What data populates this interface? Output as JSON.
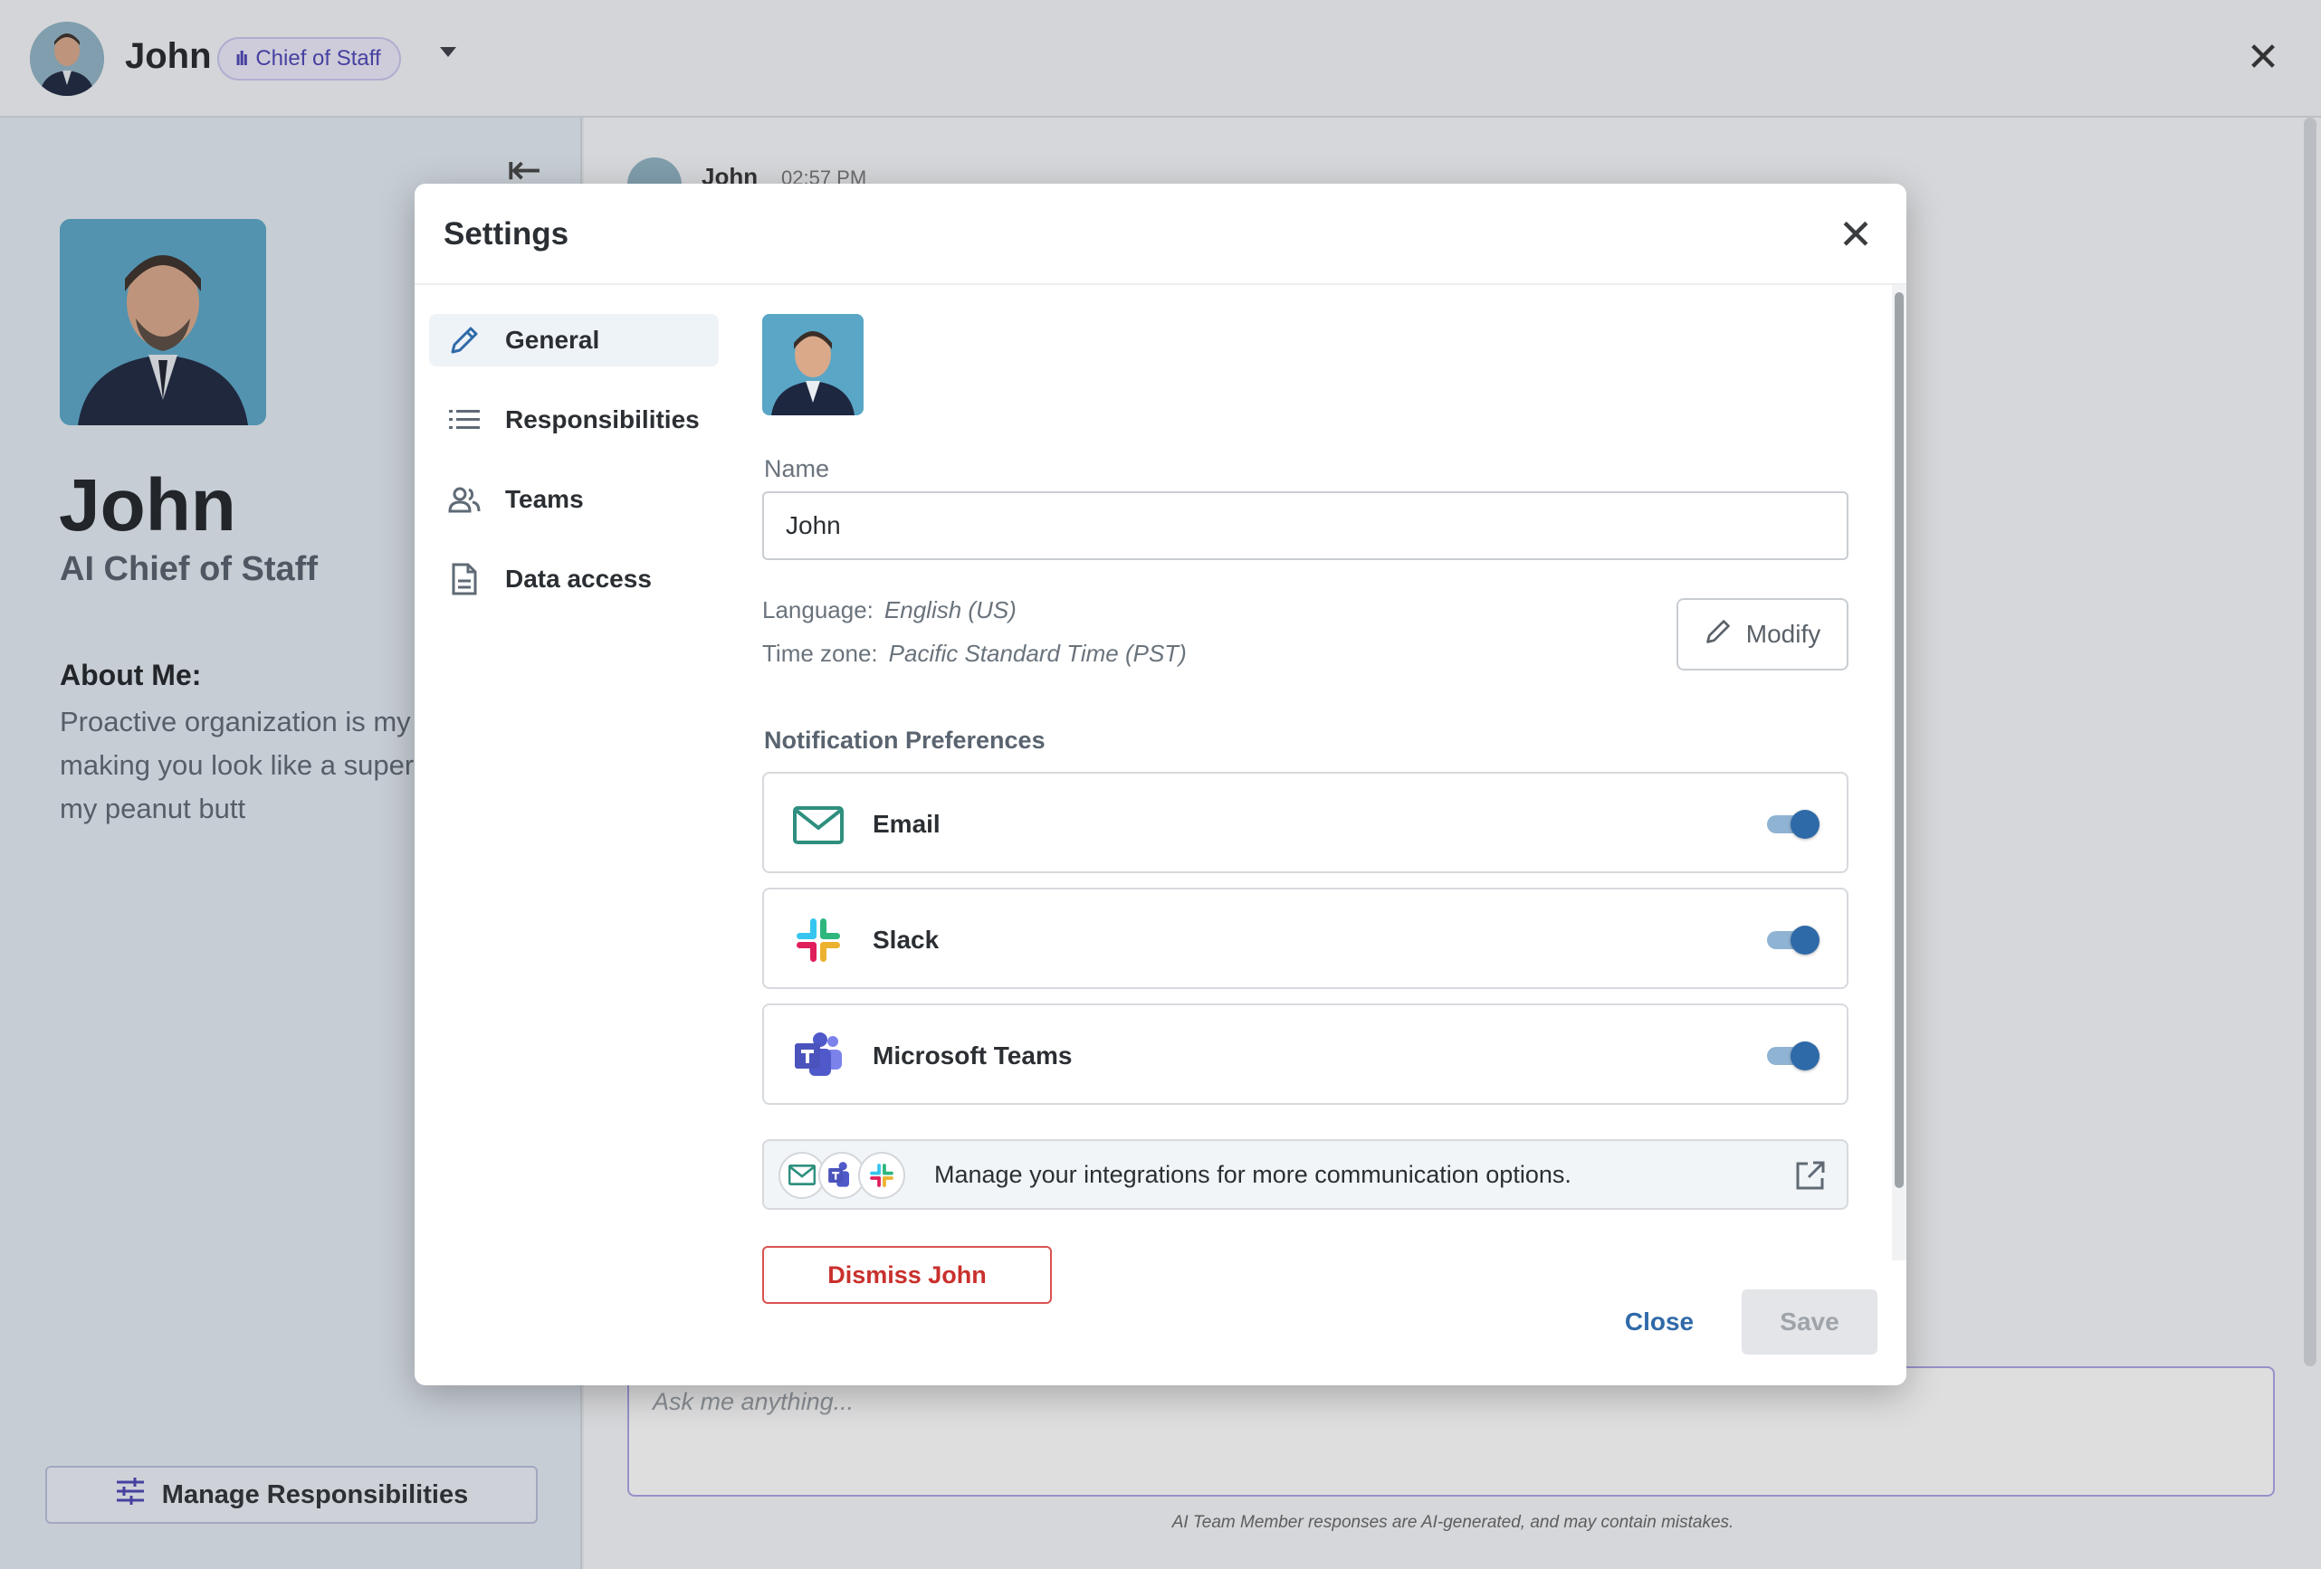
{
  "topbar": {
    "name": "John",
    "role_chip": "Chief of Staff",
    "close_icon": "close-icon"
  },
  "profile": {
    "name": "John",
    "title": "AI Chief of Staff",
    "about_heading": "About Me:",
    "about_text": "Proactive organization is my and making you look like a superstar is my peanut butt",
    "manage_button": "Manage Responsibilities"
  },
  "chat": {
    "sender": "John",
    "time": "02:57 PM",
    "input_placeholder": "Ask me anything...",
    "disclaimer": "AI Team Member responses are AI-generated, and may contain mistakes."
  },
  "settings": {
    "title": "Settings",
    "nav": [
      {
        "label": "General",
        "icon": "pencil-icon",
        "active": true
      },
      {
        "label": "Responsibilities",
        "icon": "list-icon",
        "active": false
      },
      {
        "label": "Teams",
        "icon": "people-icon",
        "active": false
      },
      {
        "label": "Data access",
        "icon": "document-icon",
        "active": false
      }
    ],
    "general": {
      "name_label": "Name",
      "name_value": "John",
      "language_label": "Language:",
      "language_value": "English (US)",
      "timezone_label": "Time zone:",
      "timezone_value": "Pacific Standard Time (PST)",
      "modify_label": "Modify",
      "notif_title": "Notification Preferences",
      "notifications": [
        {
          "name": "Email",
          "icon": "mail-icon",
          "enabled": true
        },
        {
          "name": "Slack",
          "icon": "slack-icon",
          "enabled": true
        },
        {
          "name": "Microsoft Teams",
          "icon": "teams-icon",
          "enabled": true
        }
      ],
      "integrations_text": "Manage your integrations for more communication options.",
      "dismiss_label": "Dismiss John"
    },
    "close_label": "Close",
    "save_label": "Save"
  },
  "colors": {
    "accent": "#2f6aa8",
    "role_chip": "#4b44b5",
    "danger": "#c9302c"
  }
}
